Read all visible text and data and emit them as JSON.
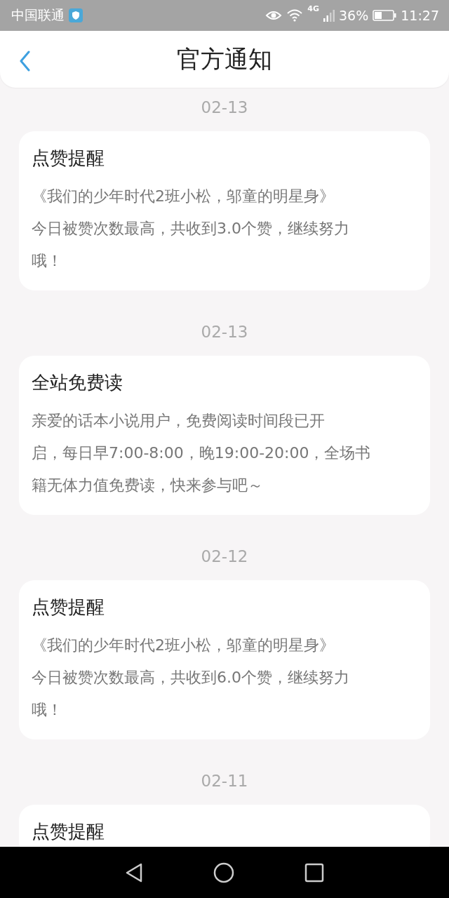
{
  "status_bar": {
    "carrier": "中国联通",
    "network": "4G",
    "battery": "36%",
    "time": "11:27"
  },
  "header": {
    "title": "官方通知"
  },
  "notifications": [
    {
      "date": "02-13",
      "title": "点赞提醒",
      "body_lines": [
        "《我们的少年时代2班小松，邬童的明星身》",
        "今日被赞次数最高，共收到3.0个赞，继续努力",
        "哦！"
      ]
    },
    {
      "date": "02-13",
      "title": "全站免费读",
      "body_lines": [
        "亲爱的话本小说用户，免费阅读时间段已开",
        "启，每日早7:00-8:00，晚19:00-20:00，全场书",
        "籍无体力值免费读，快来参与吧～"
      ]
    },
    {
      "date": "02-12",
      "title": "点赞提醒",
      "body_lines": [
        "《我们的少年时代2班小松，邬童的明星身》",
        "今日被赞次数最高，共收到6.0个赞，继续努力",
        "哦！"
      ]
    },
    {
      "date": "02-11",
      "title": "点赞提醒"
    }
  ]
}
